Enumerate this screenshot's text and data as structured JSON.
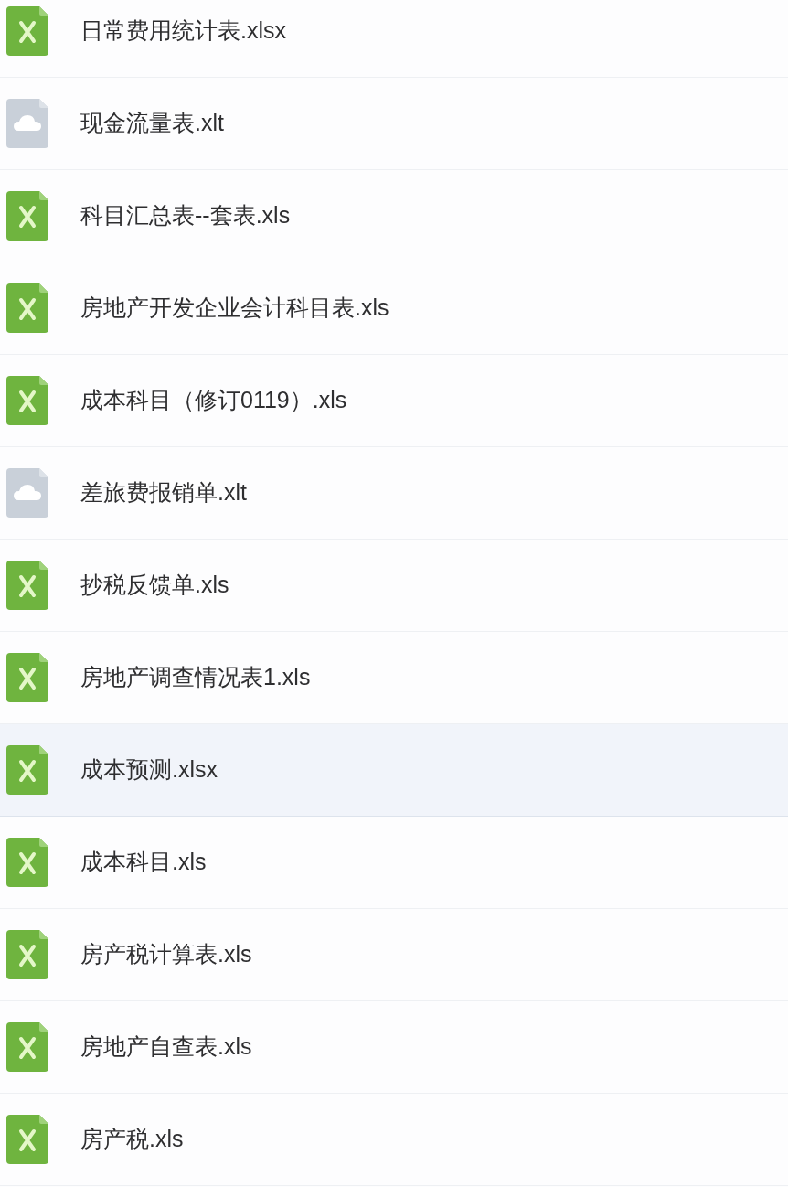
{
  "file_list": {
    "items": [
      {
        "name": "日常费用统计表.xlsx",
        "kind": "excel",
        "selected": false
      },
      {
        "name": "现金流量表.xlt",
        "kind": "cloud",
        "selected": false
      },
      {
        "name": "科目汇总表--套表.xls",
        "kind": "excel",
        "selected": false
      },
      {
        "name": "房地产开发企业会计科目表.xls",
        "kind": "excel",
        "selected": false
      },
      {
        "name": "成本科目（修订0119）.xls",
        "kind": "excel",
        "selected": false
      },
      {
        "name": "差旅费报销单.xlt",
        "kind": "cloud",
        "selected": false
      },
      {
        "name": "抄税反馈单.xls",
        "kind": "excel",
        "selected": false
      },
      {
        "name": "房地产调查情况表1.xls",
        "kind": "excel",
        "selected": false
      },
      {
        "name": "成本预测.xlsx",
        "kind": "excel",
        "selected": true
      },
      {
        "name": "成本科目.xls",
        "kind": "excel",
        "selected": false
      },
      {
        "name": "房产税计算表.xls",
        "kind": "excel",
        "selected": false
      },
      {
        "name": "房地产自查表.xls",
        "kind": "excel",
        "selected": false
      },
      {
        "name": "房产税.xls",
        "kind": "excel",
        "selected": false
      }
    ]
  }
}
